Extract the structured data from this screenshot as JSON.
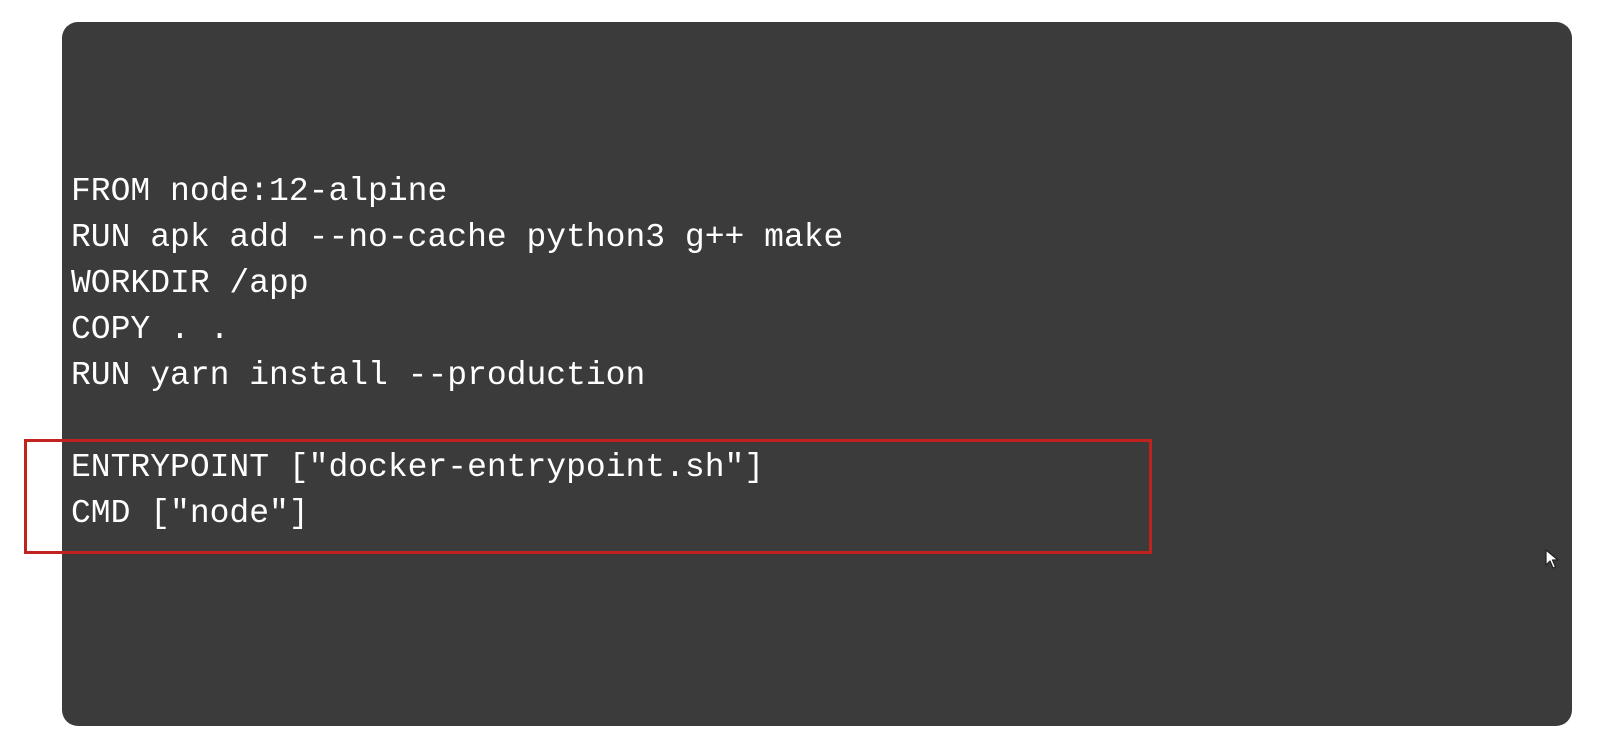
{
  "code": {
    "lines": [
      "FROM node:12-alpine",
      "RUN apk add --no-cache python3 g++ make",
      "WORKDIR /app",
      "COPY . .",
      "RUN yarn install --production",
      "",
      "ENTRYPOINT [\"docker-entrypoint.sh\"]",
      "CMD [\"node\"]"
    ]
  },
  "colors": {
    "panel_background": "#3b3b3b",
    "text": "#ffffff",
    "highlight": "#c0231d"
  },
  "icons": {
    "cursor": "mouse-pointer-icon"
  }
}
